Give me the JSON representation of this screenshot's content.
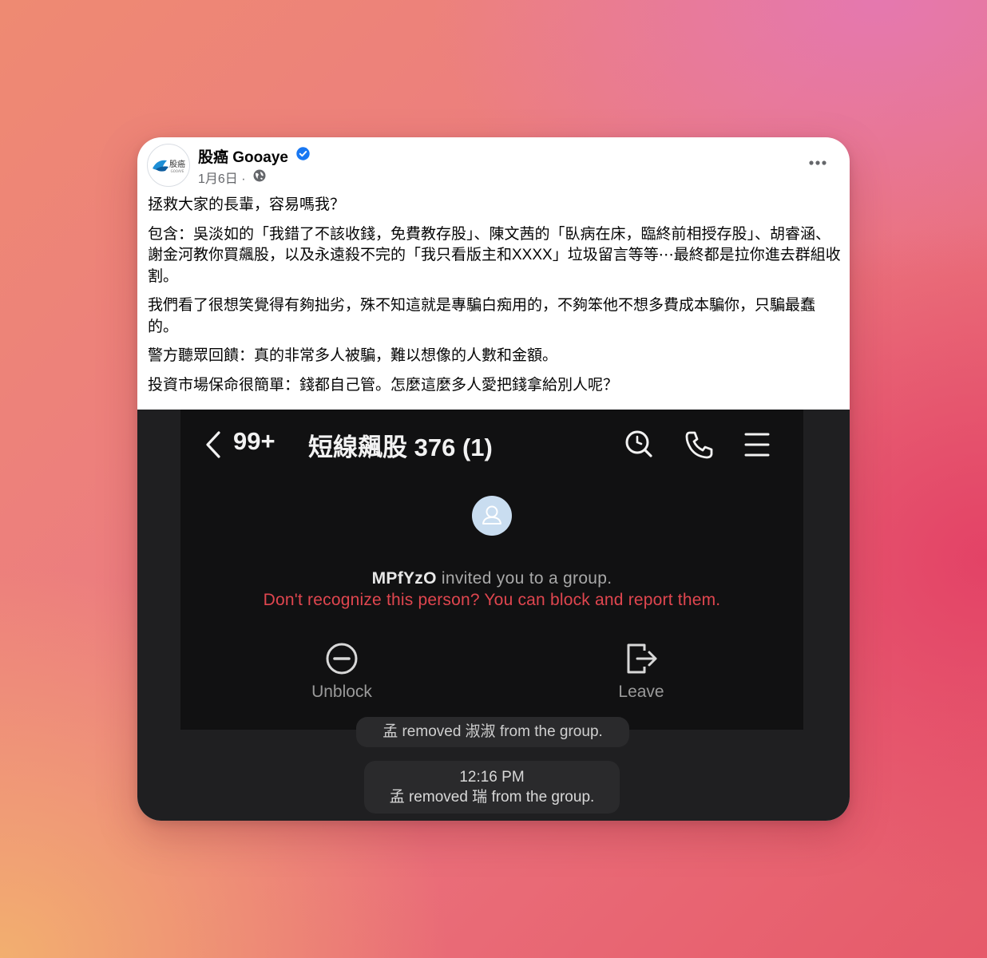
{
  "post": {
    "page_name": "股癌 Gooaye",
    "date": "1月6日 ·",
    "avatar_text": "股癌",
    "avatar_subtext": "GOOAYE",
    "paragraphs": [
      "拯救大家的長輩，容易嗎我？",
      "包含：吳淡如的「我錯了不該收錢，免費教存股」、陳文茜的「臥病在床，臨終前相授存股」、胡睿涵、謝金河教你買飆股，以及永遠殺不完的「我只看版主和XXXX」垃圾留言等等⋯最終都是拉你進去群組收割。",
      "我們看了很想笑覺得有夠拙劣，殊不知這就是專騙白痴用的，不夠笨他不想多費成本騙你，只騙最蠢的。",
      "警方聽眾回饋：真的非常多人被騙，難以想像的人數和金額。",
      "投資市場保命很簡單：錢都自己管。怎麼這麼多人愛把錢拿給別人呢？"
    ]
  },
  "chat": {
    "unread_count": "99+",
    "group_title": "短線飆股 376 (1)",
    "inviter": "MPfYzO",
    "invite_text": " invited you to a group.",
    "warning": "Don't recognize this person? You can block and report them.",
    "unblock_label": "Unblock",
    "leave_label": "Leave",
    "cut_message": "孟 removed 淑淑 from the group.",
    "time": "12:16 PM",
    "removed_message": "孟 removed 瑞 from the group."
  },
  "colors": {
    "verified": "#1877f2",
    "warning": "#e0464f",
    "chat_bg": "#111112"
  },
  "icons": [
    "verified-icon",
    "globe-icon",
    "more-icon",
    "back-icon",
    "search-icon",
    "phone-icon",
    "menu-icon",
    "user-icon",
    "unblock-icon",
    "leave-icon"
  ]
}
